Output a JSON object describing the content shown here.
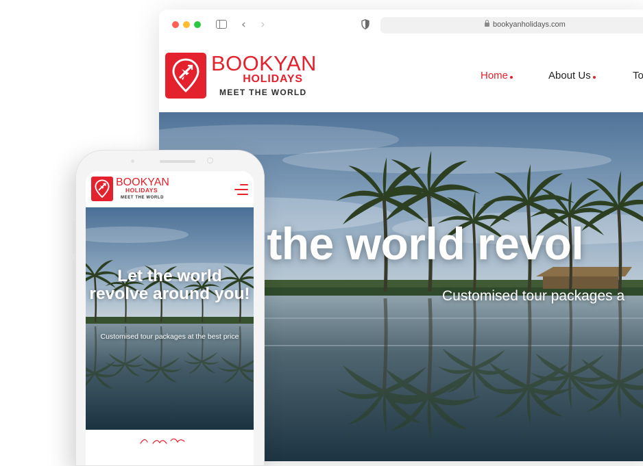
{
  "browser": {
    "url": "bookyanholidays.com"
  },
  "site": {
    "brand_name": "BOOKYAN",
    "brand_sub": "HOLIDAYS",
    "brand_tagline": "MEET THE WORLD",
    "nav": [
      {
        "label": "Home",
        "active": true
      },
      {
        "label": "About Us",
        "active": false
      },
      {
        "label": "To",
        "active": false
      }
    ],
    "hero_title": "t the world revol",
    "hero_subtitle": "Customised tour packages a"
  },
  "phone": {
    "brand_name": "BOOKYAN",
    "brand_sub": "HOLIDAYS",
    "brand_tagline": "MEET THE WORLD",
    "hero_title": "Let the world revolve around you!",
    "hero_subtitle": "Customised tour packages at the best price"
  },
  "colors": {
    "brand_red": "#e3222e",
    "nav_text": "#222222",
    "tagline": "#2d2d2d"
  },
  "icons": {
    "logo": "plane-in-location-pin-icon",
    "menu": "hamburger-menu-icon",
    "lock": "lock-icon",
    "shield": "shield-icon",
    "back": "chevron-left-icon",
    "forward": "chevron-right-icon",
    "sidebar": "sidebar-toggle-icon"
  }
}
